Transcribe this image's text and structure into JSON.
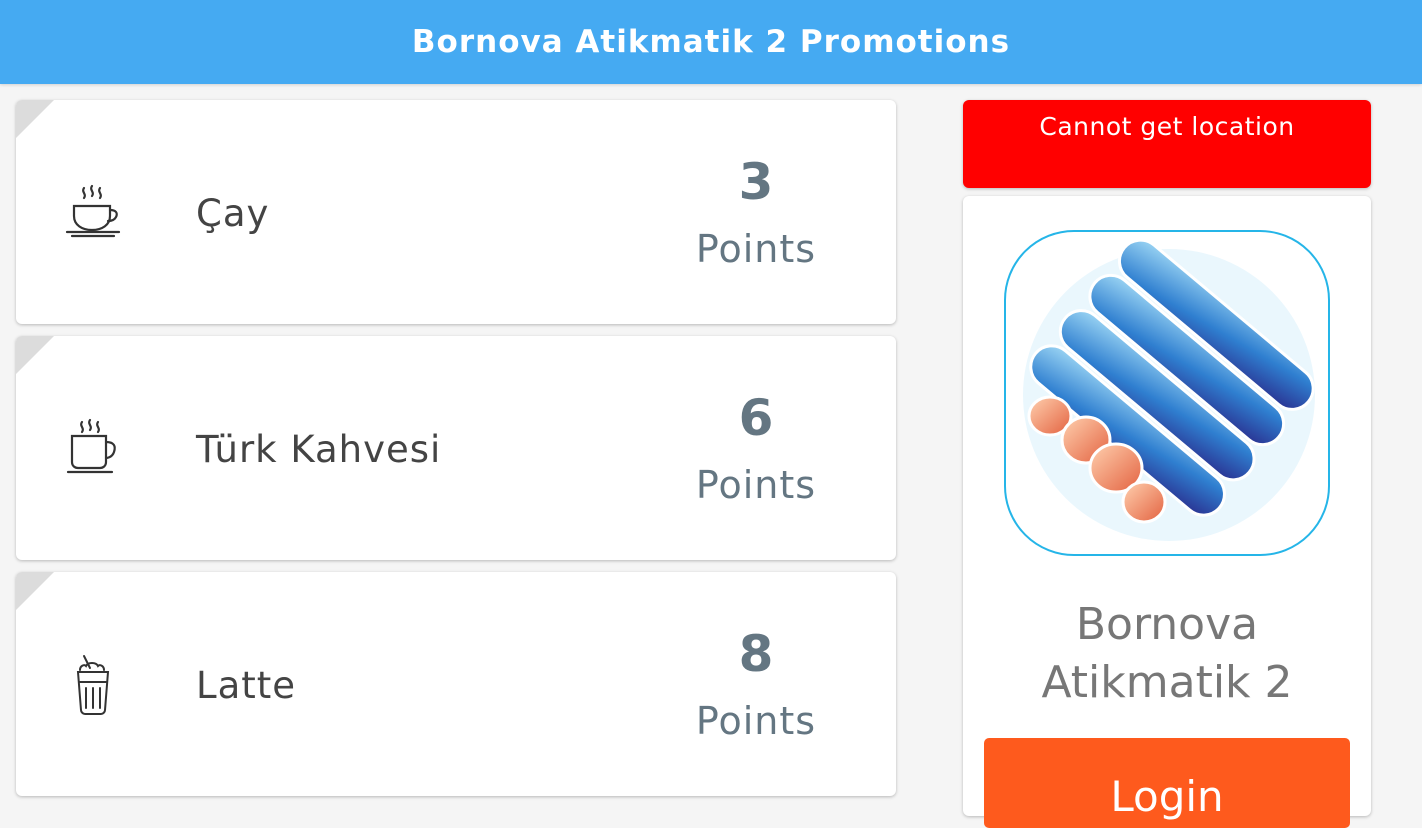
{
  "header": {
    "title": "Bornova Atikmatik 2 Promotions"
  },
  "promotions": [
    {
      "name": "Çay",
      "points_value": "3",
      "points_label": "Points",
      "icon": "tea-cup-icon"
    },
    {
      "name": "Türk Kahvesi",
      "points_value": "6",
      "points_label": "Points",
      "icon": "coffee-cup-icon"
    },
    {
      "name": "Latte",
      "points_value": "8",
      "points_label": "Points",
      "icon": "latte-glass-icon"
    }
  ],
  "sidebar": {
    "location_alert": "Cannot get location",
    "machine_name_line1": "Bornova",
    "machine_name_line2": "Atikmatik 2",
    "login_label": "Login",
    "logo_icon": "atikmatik-logo-icon"
  },
  "colors": {
    "header": "#45aaf2",
    "alert": "#ff0000",
    "login": "#fe5a1d",
    "points_text": "#647682"
  }
}
